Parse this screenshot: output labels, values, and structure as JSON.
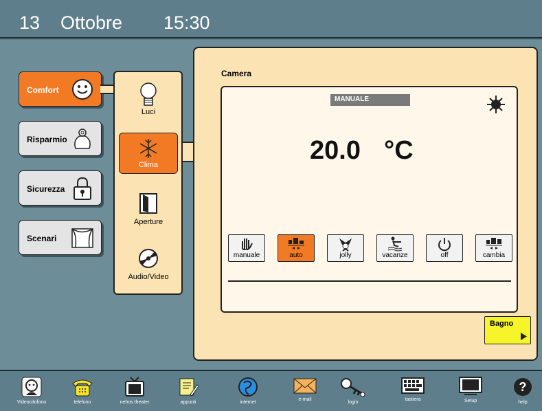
{
  "header": {
    "day": "13",
    "month": "Ottobre",
    "time": "15:30"
  },
  "categories": [
    {
      "label": "Comfort",
      "icon": "smiley-icon"
    },
    {
      "label": "Risparmio",
      "icon": "piggy-bank-icon"
    },
    {
      "label": "Sicurezza",
      "icon": "padlock-icon"
    },
    {
      "label": "Scenari",
      "icon": "theater-curtain-icon"
    }
  ],
  "submenu": [
    {
      "label": "Luci",
      "icon": "light-bulb-icon"
    },
    {
      "label": "Clima",
      "icon": "snowflake-icon"
    },
    {
      "label": "Aperture",
      "icon": "door-icon"
    },
    {
      "label": "Audio/Video",
      "icon": "cd-icon"
    }
  ],
  "room": {
    "name": "Camera",
    "mode_label": "MANUALE",
    "temperature": "20.0",
    "unit": "°C",
    "weather_icon": "sun-icon"
  },
  "modes": [
    {
      "label": "manuale",
      "icon": "hand-icon"
    },
    {
      "label": "auto",
      "icon": "schedule-icon"
    },
    {
      "label": "jolly",
      "icon": "jester-icon"
    },
    {
      "label": "vacanze",
      "icon": "water-ski-icon"
    },
    {
      "label": "off",
      "icon": "power-icon"
    },
    {
      "label": "cambia",
      "icon": "schedule-edit-icon"
    }
  ],
  "next_room": {
    "label": "Bagno"
  },
  "dock": [
    {
      "label": "Videocitofono",
      "icon": "videophone-icon"
    },
    {
      "label": "telefono",
      "icon": "telephone-icon"
    },
    {
      "label": "nehos theater",
      "icon": "tv-icon"
    },
    {
      "label": "appunti",
      "icon": "notepad-icon"
    },
    {
      "label": "internet",
      "icon": "globe-icon"
    },
    {
      "label": "e-mail",
      "icon": "envelope-icon"
    },
    {
      "label": "login",
      "icon": "key-icon"
    },
    {
      "label": "tastiera",
      "icon": "keyboard-icon"
    },
    {
      "label": "Setup",
      "icon": "monitor-icon"
    },
    {
      "label": "help",
      "icon": "help-icon"
    }
  ],
  "colors": {
    "accent": "#f27a25",
    "panel": "#fbe3b4",
    "background": "#6d8d99",
    "bar": "#5e7e8c",
    "next_button": "#f5f52a"
  }
}
